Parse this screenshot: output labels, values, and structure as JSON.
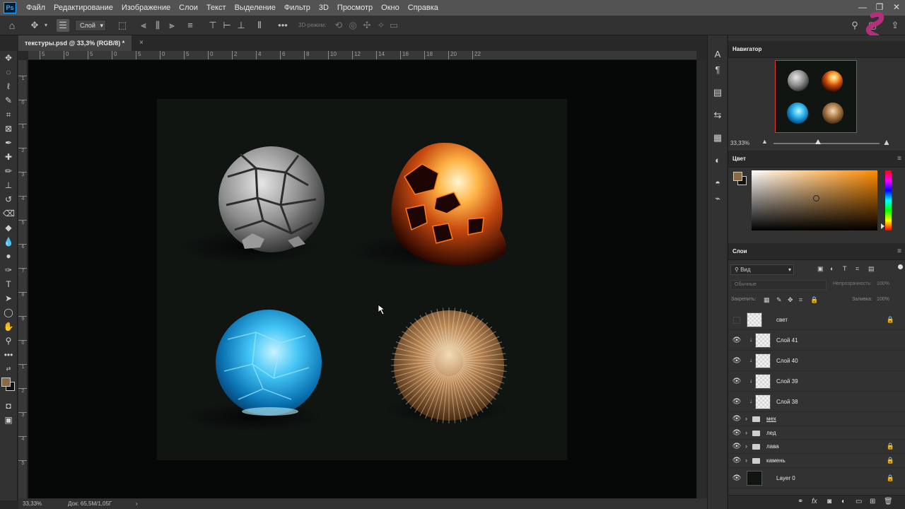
{
  "app": {
    "logo": "Ps"
  },
  "menu": [
    "Файл",
    "Редактирование",
    "Изображение",
    "Слои",
    "Текст",
    "Выделение",
    "Фильтр",
    "3D",
    "Просмотр",
    "Окно",
    "Справка"
  ],
  "window_controls": {
    "minimize": "—",
    "restore": "❐",
    "close": "✕"
  },
  "options": {
    "auto_select_value": "Слой",
    "mode_3d_label": "3D-режим:",
    "more": "•••"
  },
  "tab": {
    "title": "текстуры.psd @ 33,3% (RGB/8) *",
    "close": "×"
  },
  "ruler": {
    "h_labels": [
      "5",
      "0",
      "5",
      "0",
      "5",
      "0",
      "5",
      "0",
      "2",
      "4",
      "6",
      "8",
      "10",
      "12",
      "14",
      "16",
      "18",
      "20",
      "22"
    ],
    "v_labels": [
      "1",
      "0",
      "1",
      "2",
      "3",
      "4",
      "5",
      "6",
      "7",
      "8",
      "9",
      "0",
      "1",
      "2",
      "3",
      "4",
      "5"
    ]
  },
  "status": {
    "zoom": "33,33%",
    "doc": "Док: 65,5М/1,05Г",
    "arrow": "›"
  },
  "navigator": {
    "title": "Навигатор",
    "zoom": "33,33%"
  },
  "color": {
    "title": "Цвет",
    "foreground": "#8a6a42",
    "background": "#111111",
    "accent_hue": "#ff8c00"
  },
  "layers": {
    "title": "Слои",
    "filter_label": "Вид",
    "blend_mode": "Обычные",
    "opacity_label": "Непрозрачность:",
    "opacity_value": "100%",
    "lock_label": "Закрепить:",
    "fill_label": "Заливка:",
    "fill_value": "100%",
    "items": [
      {
        "name": "свет",
        "type": "layer",
        "visible": false,
        "locked": true,
        "clipped": false
      },
      {
        "name": "Слой 41",
        "type": "layer",
        "visible": true,
        "locked": false,
        "clipped": true
      },
      {
        "name": "Слой 40",
        "type": "layer",
        "visible": true,
        "locked": false,
        "clipped": true
      },
      {
        "name": "Слой 39",
        "type": "layer",
        "visible": true,
        "locked": false,
        "clipped": true
      },
      {
        "name": "Слой 38",
        "type": "layer",
        "visible": true,
        "locked": false,
        "clipped": true
      },
      {
        "name": "мех",
        "type": "group",
        "visible": true,
        "locked": false
      },
      {
        "name": "лед",
        "type": "group",
        "visible": true,
        "locked": false
      },
      {
        "name": "лава",
        "type": "group",
        "visible": true,
        "locked": true
      },
      {
        "name": "камень",
        "type": "group",
        "visible": true,
        "locked": true
      },
      {
        "name": "Layer 0",
        "type": "background",
        "visible": true,
        "locked": true
      }
    ]
  },
  "artwork": {
    "spheres": [
      "stone-sphere",
      "lava-sphere",
      "ice-sphere",
      "fur-sphere"
    ],
    "colors": {
      "canvas_bg": "#101512",
      "pasteboard": "#050807"
    }
  }
}
